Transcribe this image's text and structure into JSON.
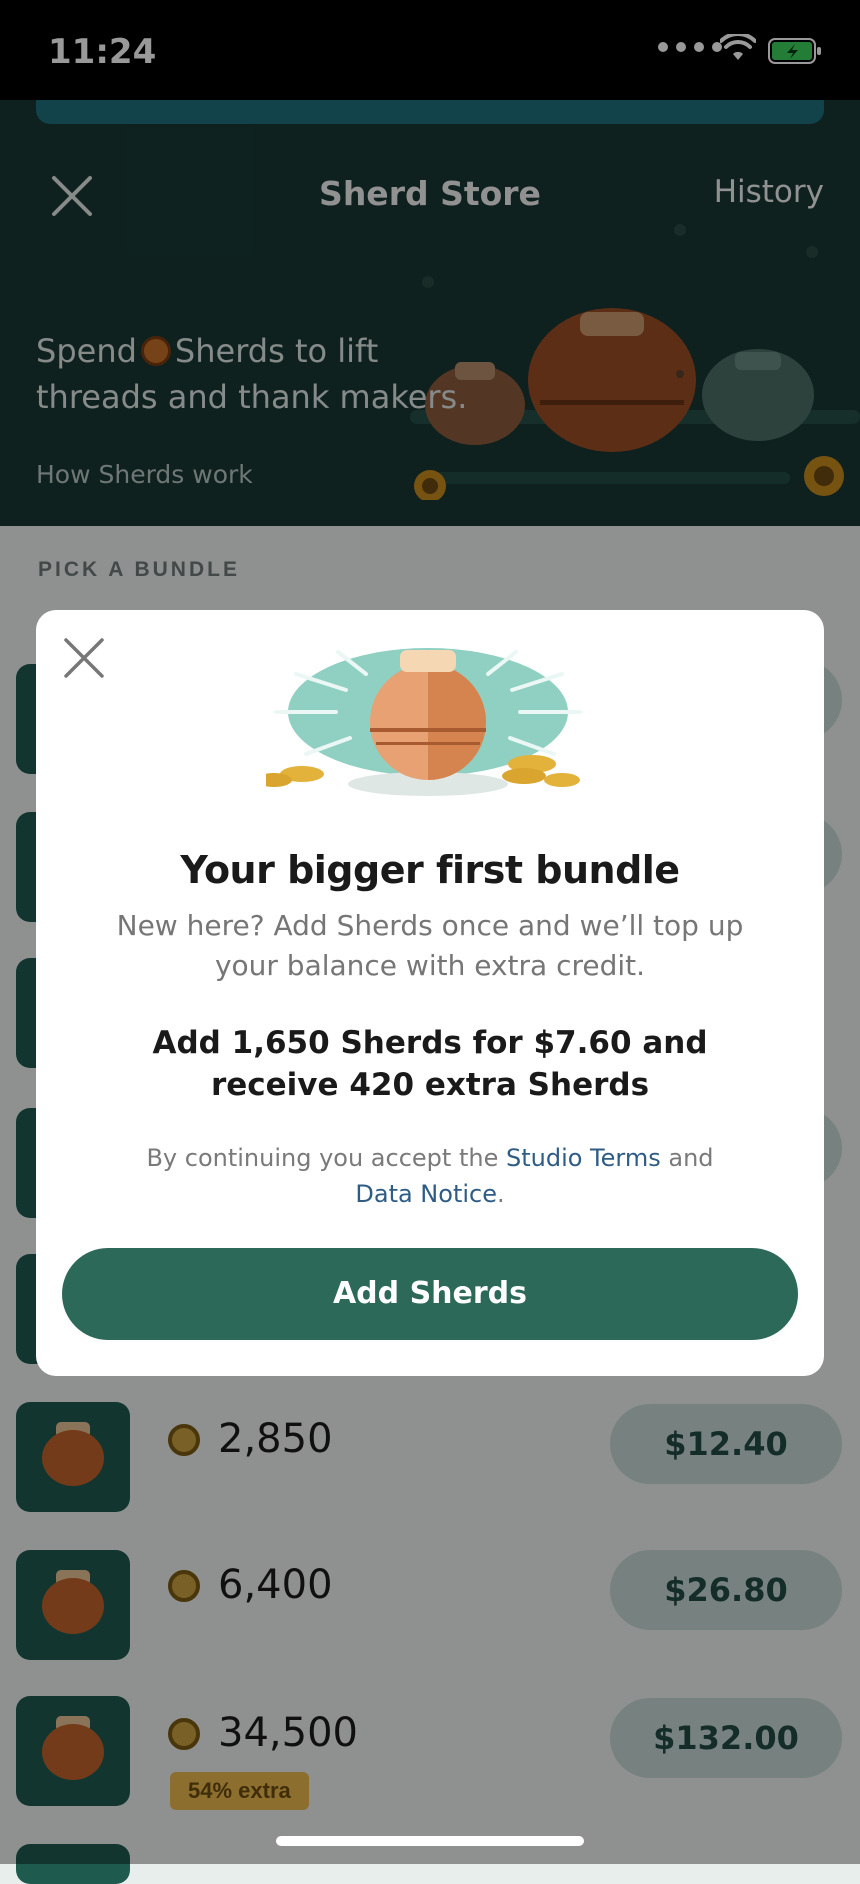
{
  "status_bar": {
    "time": "11:24"
  },
  "header": {
    "title": "Sherd Store",
    "history_label": "History",
    "description_pre": "Spend",
    "description_post": "Sherds to lift threads and thank makers.",
    "how_link": "How Sherds work",
    "strip_color": "#1f6f7c"
  },
  "section_label": "PICK A BUNDLE",
  "bundles": [
    {
      "amount": "2,850",
      "price": "$12.40",
      "extra": ""
    },
    {
      "amount": "6,400",
      "price": "$26.80",
      "extra": ""
    },
    {
      "amount": "34,500",
      "price": "$132.00",
      "extra": "54% extra"
    }
  ],
  "modal": {
    "title": "Your bigger first bundle",
    "subtitle": "New here? Add Sherds once and we’ll top up your balance with extra credit.",
    "offer": "Add 1,650 Sherds for $7.60 and receive 420 extra Sherds",
    "legal_pre": "By continuing you accept the",
    "legal_link1": "Studio Terms",
    "legal_mid": "and",
    "legal_link2": "Data Notice",
    "legal_end": ".",
    "cta_label": "Add Sherds",
    "accent_color": "#2d6959"
  },
  "icons": [
    "close-icon",
    "sherd-coin-icon",
    "jar-illustration",
    "wifi-icon",
    "battery-icon",
    "signal-dots-icon"
  ]
}
